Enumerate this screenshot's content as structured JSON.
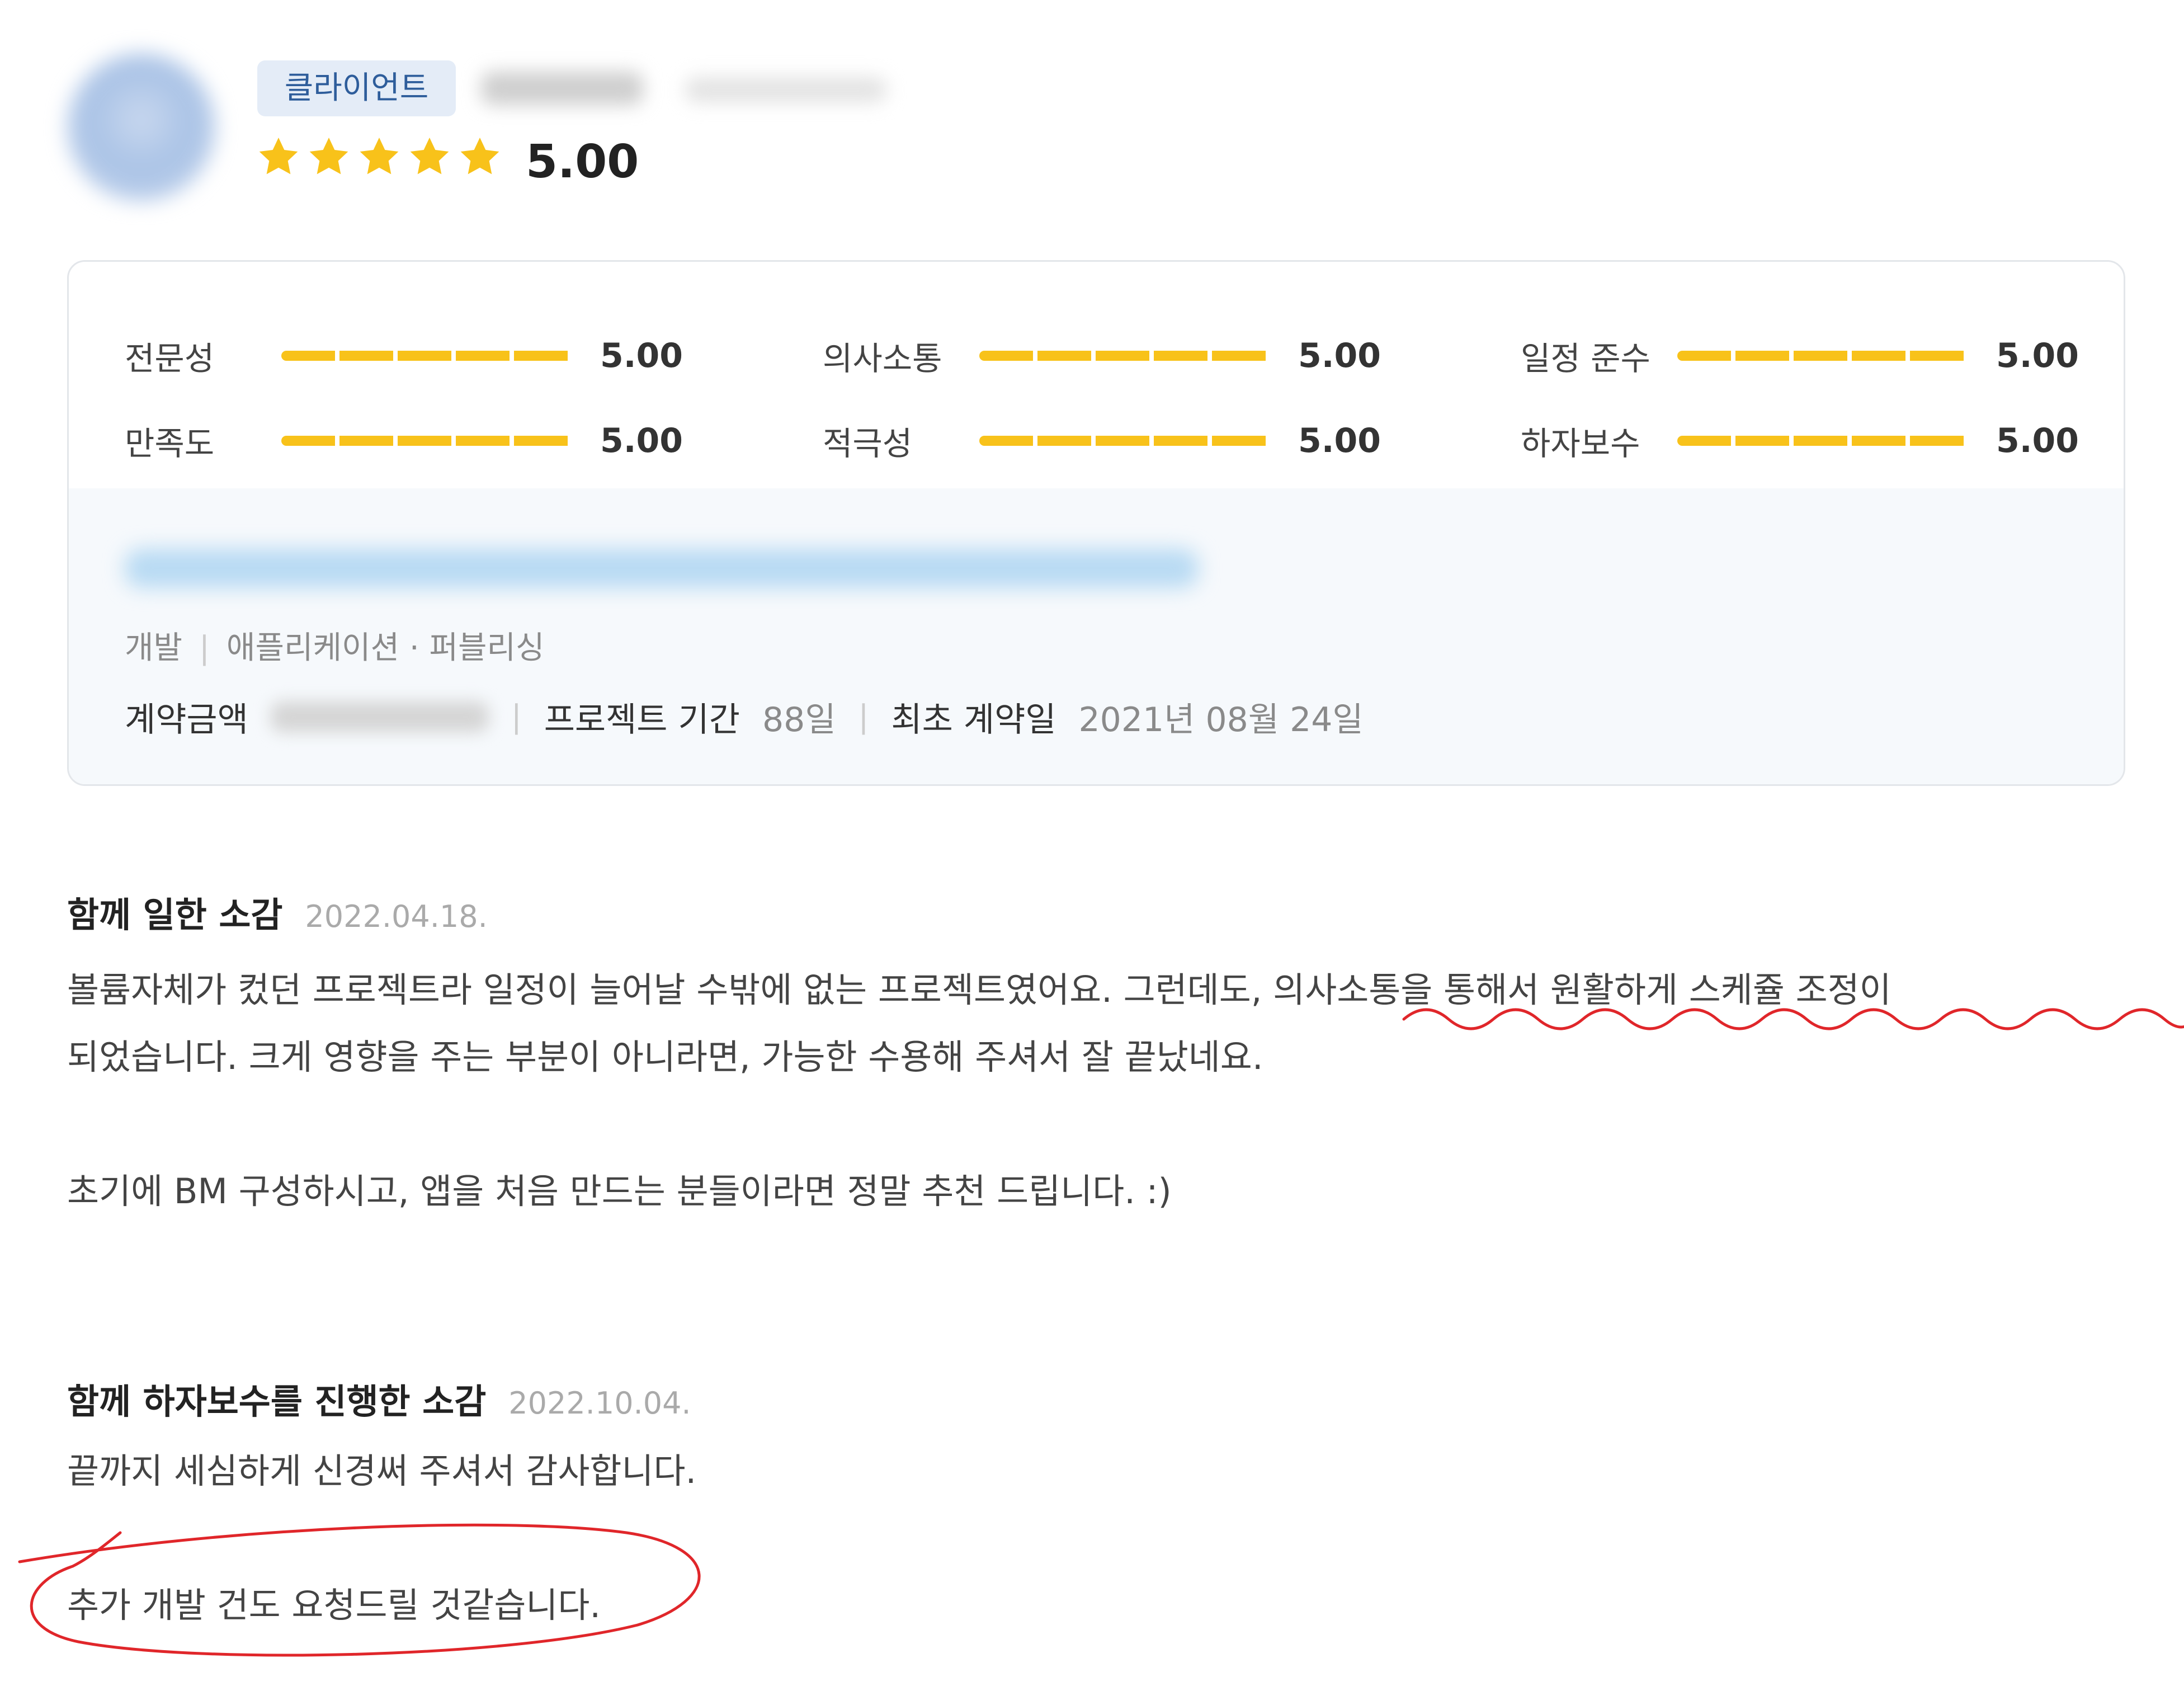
{
  "reviewer": {
    "badge": "클라이언트",
    "rating": "5.00",
    "star_count": 5
  },
  "ratings": [
    {
      "label": "전문성",
      "value": "5.00",
      "level": 1.0
    },
    {
      "label": "의사소통",
      "value": "5.00",
      "level": 1.0
    },
    {
      "label": "일정 준수",
      "value": "5.00",
      "level": 1.0
    },
    {
      "label": "만족도",
      "value": "5.00",
      "level": 1.0
    },
    {
      "label": "적극성",
      "value": "5.00",
      "level": 1.0
    },
    {
      "label": "하자보수",
      "value": "5.00",
      "level": 1.0
    }
  ],
  "project": {
    "category": "개발",
    "subcategory": "애플리케이션 · 퍼블리싱",
    "contract_amount_label": "계약금액",
    "duration_label": "프로젝트 기간",
    "duration_value": "88일",
    "first_contract_label": "최초 계약일",
    "first_contract_value": "2021년 08월 24일"
  },
  "review": {
    "title": "함께 일한 소감",
    "date": "2022.04.18.",
    "line1": "볼륨자체가 컸던 프로젝트라 일정이 늘어날 수밖에 없는 프로젝트였어요. 그런데도, 의사소통을 통해서 원활하게 스케쥴 조정이",
    "line2": "되었습니다. 크게 영향을 주는 부분이 아니라면, 가능한 수용해 주셔서 잘 끝났네요.",
    "line3": "초기에 BM 구성하시고, 앱을 처음 만드는 분들이라면 정말 추천 드립니다. :)"
  },
  "maintenance": {
    "title": "함께 하자보수를 진행한 소감",
    "date": "2022.10.04.",
    "line1": "끝까지 세심하게 신경써 주셔서 감사합니다.",
    "line2": "추가 개발 건도 요청드릴 것같습니다."
  },
  "colors": {
    "star": "#f8c21a",
    "badge_bg": "#e4ecf7",
    "badge_text": "#2e5d9b",
    "annotation": "#e0262a"
  }
}
